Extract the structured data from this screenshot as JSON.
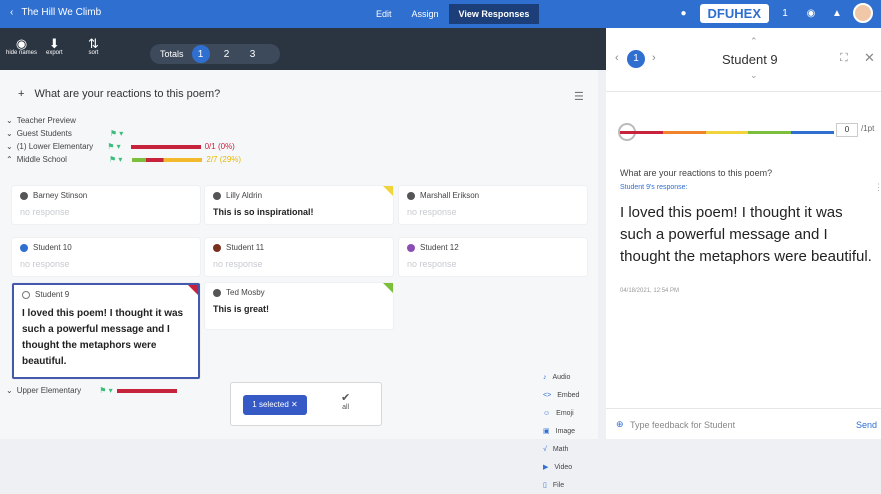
{
  "topbar": {
    "title": "The Hill We Climb",
    "tabs": [
      "Edit",
      "Assign",
      "View Responses"
    ],
    "code": "DFUHEX",
    "badge": "1"
  },
  "toolbar": {
    "tools": [
      {
        "label": "hide names",
        "icon": "eye-icon"
      },
      {
        "label": "export",
        "icon": "download-icon"
      },
      {
        "label": "sort",
        "icon": "sort-icon"
      }
    ],
    "totals_label": "Totals",
    "numbers": [
      "1",
      "2",
      "3"
    ]
  },
  "main": {
    "question": "What are your reactions to this poem?",
    "tree": [
      {
        "label": "Teacher Preview",
        "stat": ""
      },
      {
        "label": "Guest Students",
        "stat": ""
      },
      {
        "label": "(1) Lower Elementary",
        "stat": "0/1 (0%)"
      },
      {
        "label": "Middle School",
        "stat": "2/7 (29%)"
      }
    ],
    "upper": "Upper Elementary",
    "cards": [
      {
        "name": "Barney Stinson",
        "text": "no response",
        "dot": "#555"
      },
      {
        "name": "Lilly Aldrin",
        "text": "This is so inspirational!",
        "dot": "#555"
      },
      {
        "name": "Marshall Erikson",
        "text": "no response",
        "dot": "#555"
      },
      {
        "name": "Student 10",
        "text": "no response",
        "dot": "#2f6fd0"
      },
      {
        "name": "Student 11",
        "text": "no response",
        "dot": "#7b2f1f"
      },
      {
        "name": "Student 12",
        "text": "no response",
        "dot": "#8a4fb2"
      },
      {
        "name": "Student 9",
        "text": "I loved this poem! I thought it was such a powerful message and I thought the metaphors were beautiful.",
        "dot": "#777"
      },
      {
        "name": "Ted Mosby",
        "text": "This is great!",
        "dot": "#555"
      }
    ],
    "selected": "1 selected ✕",
    "all": "all",
    "popup": [
      "Audio",
      "Embed",
      "Emoji",
      "Image",
      "Math",
      "Video",
      "File"
    ]
  },
  "pane": {
    "number": "1",
    "student": "Student 9",
    "score": "0",
    "score_unit": "/1pt",
    "question": "What are your reactions to this poem?",
    "resp_label": "Student 9's response:",
    "answer": "I loved this poem! I thought it was such a powerful message and I thought the metaphors were beautiful.",
    "timestamp": "04/18/2021, 12:54 PM",
    "feedback_placeholder": "Type feedback for Student",
    "send": "Send"
  },
  "colors": {
    "accent": "#2f6fd0",
    "selected": "#3559c5",
    "dark": "#2b3441"
  }
}
